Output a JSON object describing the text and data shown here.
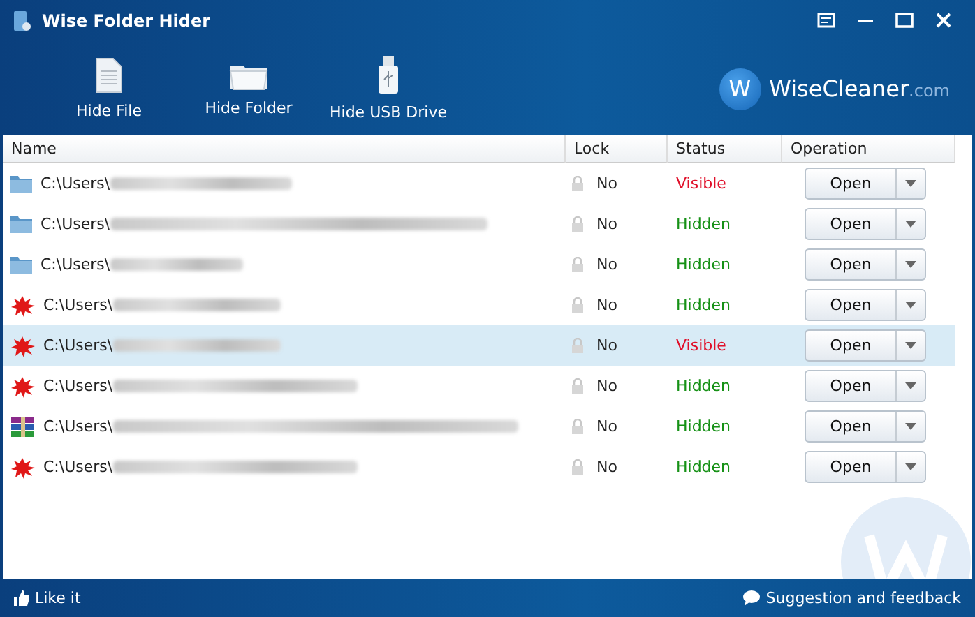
{
  "window": {
    "title": "Wise Folder Hider"
  },
  "toolbar": [
    {
      "kind": "file",
      "label": "Hide File"
    },
    {
      "kind": "folder",
      "label": "Hide Folder"
    },
    {
      "kind": "usb",
      "label": "Hide USB Drive"
    }
  ],
  "brand": {
    "name": "WiseCleaner",
    "suffix": ".com",
    "mark": "W"
  },
  "table": {
    "columns": [
      "Name",
      "Lock",
      "Status",
      "Operation"
    ],
    "rows": [
      {
        "kind": "folder",
        "path": "C:\\Users\\",
        "lock": "No",
        "status": "Visible",
        "hidden": false,
        "selected": false,
        "action": "Open"
      },
      {
        "kind": "folder",
        "path": "C:\\Users\\",
        "lock": "No",
        "status": "Hidden",
        "hidden": true,
        "selected": false,
        "action": "Open"
      },
      {
        "kind": "folder",
        "path": "C:\\Users\\",
        "lock": "No",
        "status": "Hidden",
        "hidden": true,
        "selected": false,
        "action": "Open"
      },
      {
        "kind": "image",
        "path": "C:\\Users\\",
        "lock": "No",
        "status": "Hidden",
        "hidden": true,
        "selected": false,
        "action": "Open"
      },
      {
        "kind": "image",
        "path": "C:\\Users\\",
        "lock": "No",
        "status": "Visible",
        "hidden": false,
        "selected": true,
        "action": "Open"
      },
      {
        "kind": "image",
        "path": "C:\\Users\\",
        "lock": "No",
        "status": "Hidden",
        "hidden": true,
        "selected": false,
        "action": "Open"
      },
      {
        "kind": "archive",
        "path": "C:\\Users\\",
        "lock": "No",
        "status": "Hidden",
        "hidden": true,
        "selected": false,
        "action": "Open"
      },
      {
        "kind": "image",
        "path": "C:\\Users\\",
        "lock": "No",
        "status": "Hidden",
        "hidden": true,
        "selected": false,
        "action": "Open"
      }
    ]
  },
  "status_bar": {
    "left": "Like it",
    "right": "Suggestion and feedback"
  }
}
